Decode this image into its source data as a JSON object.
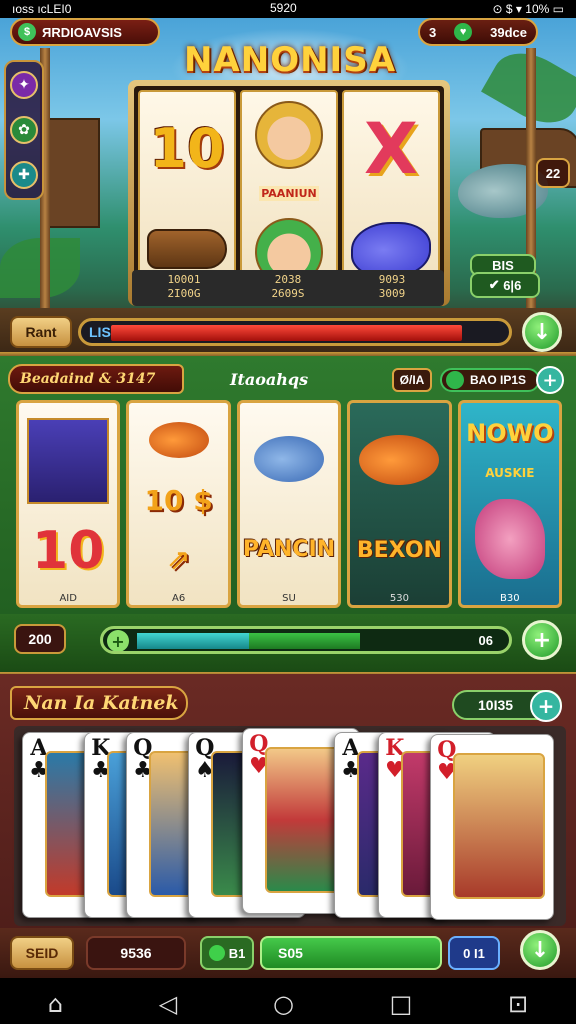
{
  "status_bar": {
    "left": "ıoss ıcLEI0",
    "center": "5920",
    "battery": "10%"
  },
  "top": {
    "title_pill": "ЯRDIOAVSIS",
    "coins_left": "3",
    "coins_right": "39dce",
    "game_title": "NANONISA",
    "side_badge": "22",
    "bottom_badge": "6|6",
    "bottom_badge_top": "BIS",
    "reel_texts": {
      "top_left": "10",
      "mid_center": "PAANIUN",
      "top_right": "X"
    },
    "reel_stats": [
      {
        "line1": "10001",
        "line2": "2I00G"
      },
      {
        "line1": "2038",
        "line2": "2609S"
      },
      {
        "line1": "9093",
        "line2": "3009"
      }
    ],
    "bar": {
      "button": "Rant",
      "track_label": "LIS",
      "progress": 0.9
    }
  },
  "middle": {
    "header_left": "Beadaind & 3147",
    "header_mid": "Itaoahqs",
    "header_r1": "Ø/IA",
    "header_r2": "BAO IP1S",
    "cards": [
      {
        "big": "10",
        "foot": "AID"
      },
      {
        "top": "10 $",
        "foot": "A6"
      },
      {
        "word": "PANCIN",
        "foot": "SU"
      },
      {
        "word": "BEXON",
        "foot": "530"
      },
      {
        "title": "NOWO",
        "sub": "AUSKIE",
        "foot": "B30"
      }
    ],
    "bar": {
      "value": "200",
      "right": "06",
      "progress_cyan": 0.3,
      "progress_green": 0.6
    }
  },
  "bottom": {
    "header": "Nan Ia Katnek",
    "count": "10I35",
    "cards": [
      {
        "rank": "A",
        "suit": "♣",
        "color": "blk"
      },
      {
        "rank": "K",
        "suit": "♣",
        "color": "blk"
      },
      {
        "rank": "Q",
        "suit": "♣",
        "color": "blk"
      },
      {
        "rank": "Q",
        "suit": "♠",
        "color": "blk"
      },
      {
        "rank": "Q",
        "suit": "♥",
        "color": "red"
      },
      {
        "rank": "A",
        "suit": "♣",
        "color": "blk"
      },
      {
        "rank": "K",
        "suit": "♥",
        "color": "red"
      },
      {
        "rank": "Q",
        "suit": "♥",
        "color": "red"
      }
    ],
    "bar": {
      "button": "SEID",
      "value": "9536",
      "chip": "B1",
      "green": "S05",
      "blue": "0 I1"
    }
  },
  "colors": {
    "accent_gold": "#d9a441",
    "green": "#2fb64a",
    "red": "#d21f2a"
  }
}
